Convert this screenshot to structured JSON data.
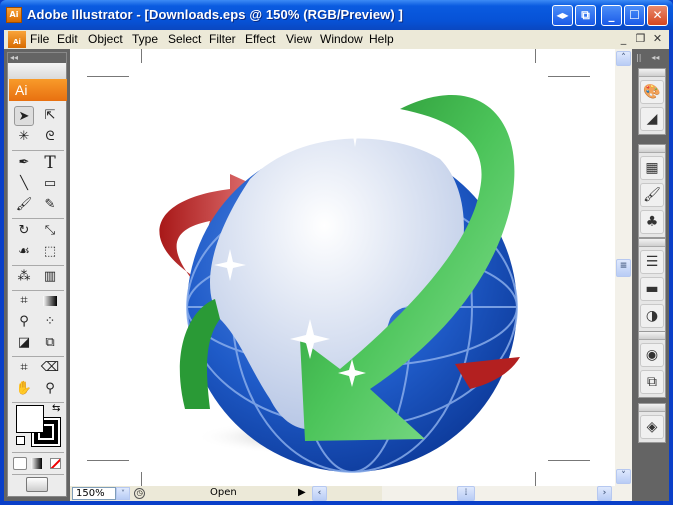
{
  "window": {
    "title": "Adobe Illustrator - [Downloads.eps @ 150% (RGB/Preview) ]",
    "app_icon_label": "Ai",
    "controls": [
      "expand-icon",
      "restore-down-icon",
      "minimize-icon",
      "maximize-icon",
      "close-icon"
    ]
  },
  "menubar": {
    "items": [
      {
        "label": "File",
        "accel": "F"
      },
      {
        "label": "Edit",
        "accel": "E"
      },
      {
        "label": "Object",
        "accel": "O"
      },
      {
        "label": "Type",
        "accel": "T"
      },
      {
        "label": "Select",
        "accel": "S"
      },
      {
        "label": "Filter",
        "accel": "l"
      },
      {
        "label": "Effect",
        "accel": "c"
      },
      {
        "label": "View",
        "accel": "V"
      },
      {
        "label": "Window",
        "accel": "W"
      },
      {
        "label": "Help",
        "accel": "H"
      }
    ],
    "doc_controls": {
      "minimize": "_",
      "restore": "❐",
      "close": "✕"
    }
  },
  "toolbox": {
    "collapse_glyph": "◂◂",
    "logo": "Ai",
    "tools": [
      {
        "name": "selection-tool",
        "glyph": "➤",
        "selected": true
      },
      {
        "name": "direct-selection-tool",
        "glyph": "⇱"
      },
      {
        "name": "magic-wand-tool",
        "glyph": "✳"
      },
      {
        "name": "lasso-tool",
        "glyph": "ᘓ"
      },
      {
        "name": "pen-tool",
        "glyph": "✒"
      },
      {
        "name": "type-tool",
        "glyph": "T"
      },
      {
        "name": "line-tool",
        "glyph": "╲"
      },
      {
        "name": "rectangle-tool",
        "glyph": "▭"
      },
      {
        "name": "paintbrush-tool",
        "glyph": "🖌"
      },
      {
        "name": "pencil-tool",
        "glyph": "✎"
      },
      {
        "name": "rotate-tool",
        "glyph": "↻"
      },
      {
        "name": "scale-tool",
        "glyph": "⤡"
      },
      {
        "name": "warp-tool",
        "glyph": "☙"
      },
      {
        "name": "free-transform-tool",
        "glyph": "⬚"
      },
      {
        "name": "symbol-sprayer-tool",
        "glyph": "⁂"
      },
      {
        "name": "column-graph-tool",
        "glyph": "▥"
      },
      {
        "name": "mesh-tool",
        "glyph": "⌗"
      },
      {
        "name": "gradient-tool",
        "glyph": "▬"
      },
      {
        "name": "eyedropper-tool",
        "glyph": "⚲"
      },
      {
        "name": "blend-tool",
        "glyph": "⁘"
      },
      {
        "name": "live-paint-bucket-tool",
        "glyph": "◪"
      },
      {
        "name": "live-paint-selection-tool",
        "glyph": "⧉"
      },
      {
        "name": "slice-tool",
        "glyph": "⌗"
      },
      {
        "name": "eraser-tool",
        "glyph": "⌫"
      },
      {
        "name": "hand-tool",
        "glyph": "✋"
      },
      {
        "name": "zoom-tool",
        "glyph": "🔍"
      }
    ],
    "fill_color": "#ffffff",
    "stroke_color": "#000000",
    "swap_glyph": "⇆",
    "mode_buttons": [
      "color-mode",
      "gradient-mode",
      "none-mode"
    ]
  },
  "right_panel": {
    "collapse_glyph": "◂◂",
    "groups": [
      {
        "icons": [
          {
            "name": "color-palette-icon",
            "glyph": "🎨"
          },
          {
            "name": "color-guide-icon",
            "glyph": "◢"
          }
        ]
      },
      {
        "icons": [
          {
            "name": "swatches-icon",
            "glyph": "▦"
          },
          {
            "name": "brushes-icon",
            "glyph": "🖌"
          },
          {
            "name": "symbols-icon",
            "glyph": "♣"
          }
        ]
      },
      {
        "icons": [
          {
            "name": "stroke-icon",
            "glyph": "☰"
          },
          {
            "name": "gradient-icon",
            "glyph": "▬"
          },
          {
            "name": "transparency-icon",
            "glyph": "◑"
          }
        ]
      },
      {
        "icons": [
          {
            "name": "appearance-icon",
            "glyph": "◉"
          },
          {
            "name": "graphic-styles-icon",
            "glyph": "⧉"
          }
        ]
      },
      {
        "icons": [
          {
            "name": "layers-icon",
            "glyph": "◈"
          }
        ]
      }
    ]
  },
  "statusbar": {
    "zoom": "150%",
    "status": "Open"
  },
  "artwork": {
    "description": "Globe with red and green arrows",
    "globe_color": "#1e5bc6",
    "land_color": "#e8eef8",
    "red_arrow": "#d63a3a",
    "green_arrow": "#3fba48"
  }
}
